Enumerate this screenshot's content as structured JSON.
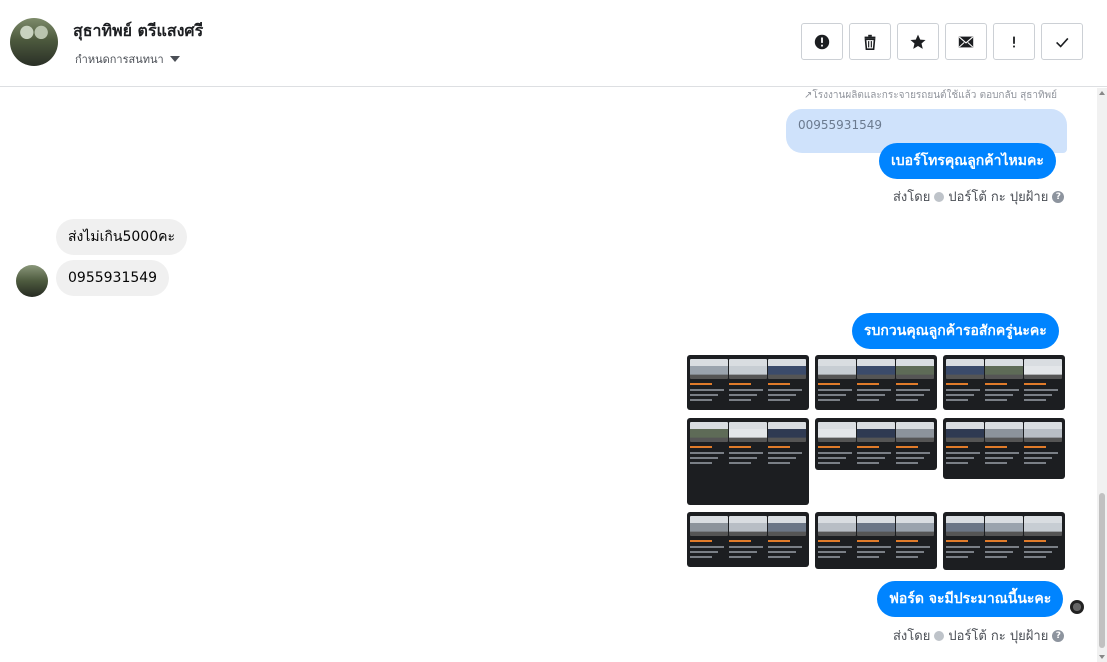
{
  "header": {
    "contact_name": "สุธาทิพย์ ตรีแสงศรี",
    "conversation_settings_label": "กำหนดการสนทนา"
  },
  "toolbar": {
    "buttons": [
      {
        "name": "report-button",
        "icon": "alert-circle-icon"
      },
      {
        "name": "delete-button",
        "icon": "trash-icon"
      },
      {
        "name": "star-button",
        "icon": "star-icon"
      },
      {
        "name": "mark-unread-button",
        "icon": "envelope-icon"
      },
      {
        "name": "important-button",
        "icon": "exclamation-icon"
      },
      {
        "name": "done-button",
        "icon": "check-icon"
      }
    ]
  },
  "thread": {
    "reply_context": "↗โรงงานผลิตและกระจายรถยนต์ใช้แล้ว ตอบกลับ สุธาทิพย์",
    "quoted_text": "00955931549",
    "messages": [
      {
        "direction": "out",
        "text": "เบอร์โทรคุณลูกค้าไหมคะ"
      },
      {
        "direction": "in",
        "text": "ส่งไม่เกิน5000คะ"
      },
      {
        "direction": "in",
        "text": "0955931549"
      },
      {
        "direction": "out",
        "text": "รบกวนคุณลูกค้ารอสักครู่นะคะ"
      },
      {
        "direction": "out",
        "text": "ฟอร์ด จะมีประมาณนี้นะคะ"
      }
    ],
    "sent_by_prefix": "ส่งโดย",
    "sent_by_name": "ปอร์โต้ กะ ปุยฝ้าย",
    "help_glyph": "?",
    "photo_count": 9
  },
  "colors": {
    "outgoing_bubble": "#0084ff",
    "incoming_bubble": "#f0f0f0",
    "quoted_bubble": "#cfe2fb",
    "photo_bg": "#1c1e21"
  }
}
